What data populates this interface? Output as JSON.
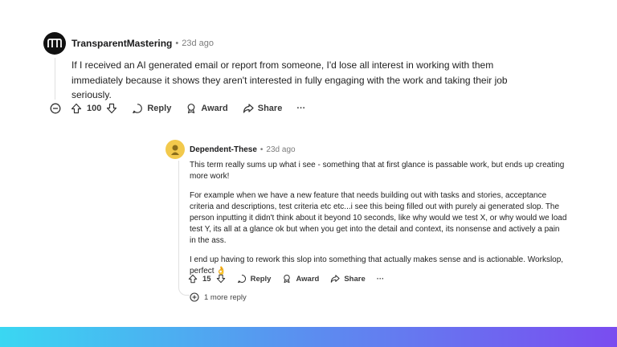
{
  "comment1": {
    "author": "TransparentMastering",
    "separator": "•",
    "time": "23d ago",
    "body": "If I received an AI generated email or report from someone, I'd lose all interest in working with them immediately because it shows they aren't interested in fully engaging with the work and taking their job seriously.",
    "votes": "100",
    "reply_label": "Reply",
    "award_label": "Award",
    "share_label": "Share",
    "more_label": "···"
  },
  "comment2": {
    "author": "Dependent-These",
    "separator": "•",
    "time": "23d ago",
    "paragraphs": [
      "This term really sums up what i see - something that at first glance is passable work, but ends up creating more work!",
      " For example when we have a new feature that needs building out with tasks and stories, acceptance criteria and descriptions, test criteria etc etc...i see this being filled out with purely ai generated slop. The person inputting it didn't think about it beyond 10 seconds, like why would we test X, or why would we load test Y, its all at a glance ok but when you get into the detail and context, its nonsense and actively a pain in the ass.",
      " I end up having to rework this slop into something that actually makes sense and is actionable. Workslop, perfect 👌"
    ],
    "votes": "15",
    "reply_label": "Reply",
    "award_label": "Award",
    "share_label": "Share",
    "more_label": "···"
  },
  "more_replies": "1 more reply",
  "colors": {
    "gradient_start": "#3ad7f2",
    "gradient_mid": "#5b8ef0",
    "gradient_end": "#7a4cf0"
  }
}
